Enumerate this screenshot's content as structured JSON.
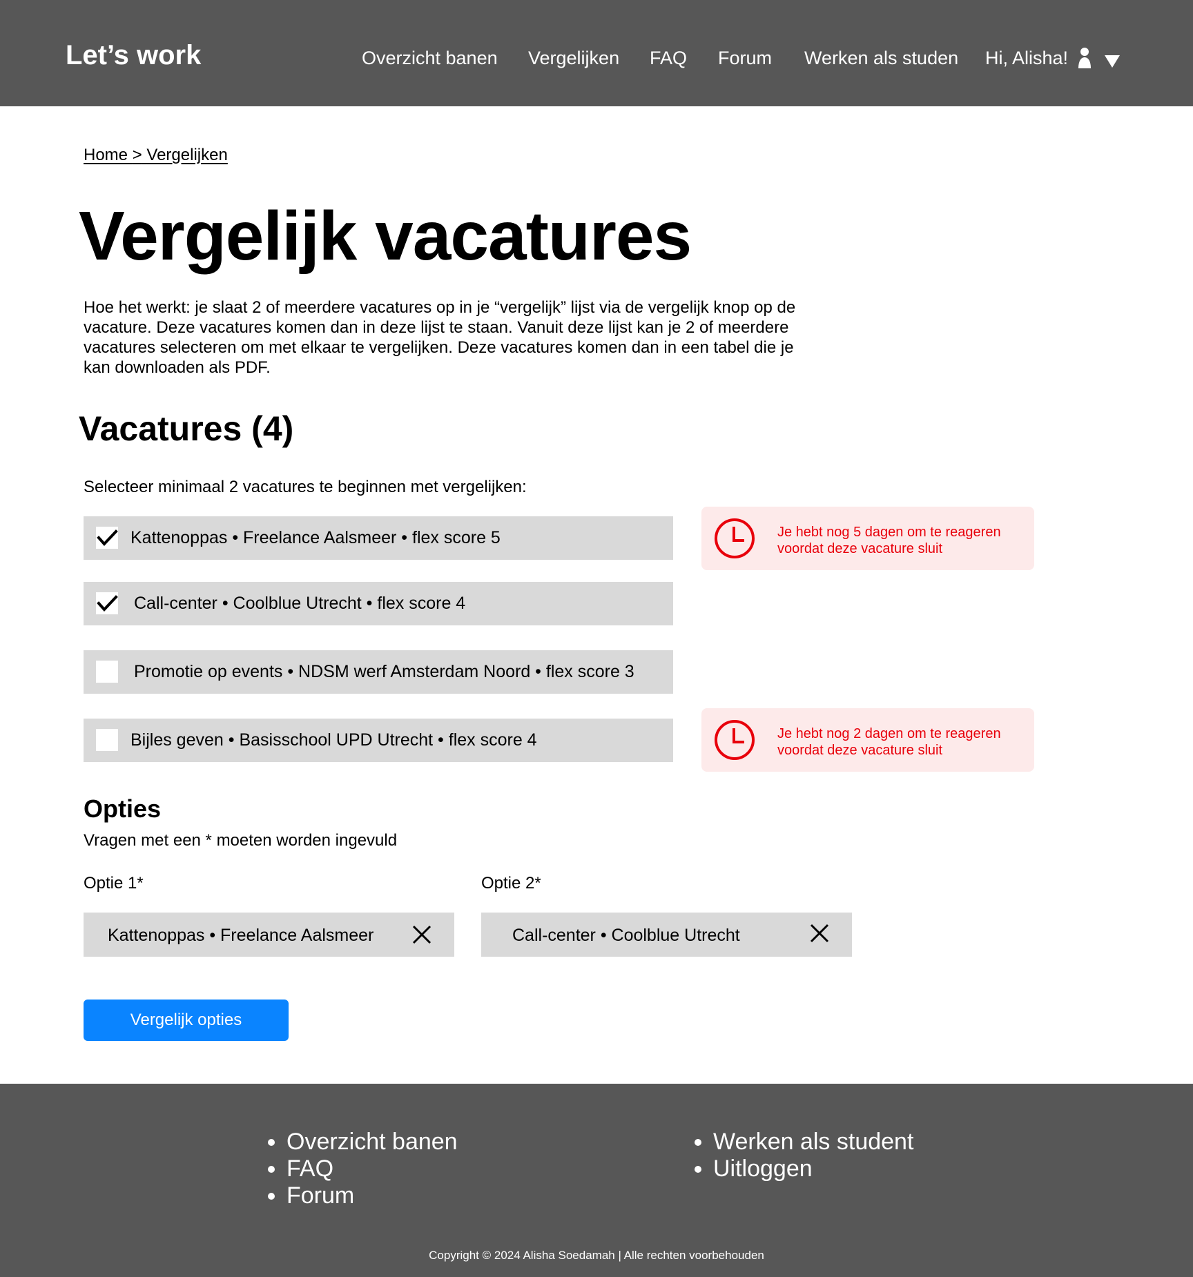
{
  "header": {
    "logo": "Let’s work",
    "nav": [
      "Overzicht banen",
      "Vergelijken",
      "FAQ",
      "Forum",
      "Werken als studen"
    ],
    "greeting": "Hi, Alisha!",
    "icons": [
      "user-icon",
      "dropdown-icon"
    ]
  },
  "breadcrumb": {
    "home": "Home",
    "separator": ">",
    "current": "Vergelijken"
  },
  "page_title": "Vergelijk vacatures",
  "intro": "Hoe het werkt: je slaat 2 of meerdere vacatures op in je “vergelijk” lijst via de vergelijk knop op de vacature. Deze vacatures komen dan in deze lijst te staan. Vanuit deze lijst kan je 2 of meerdere vacatures selecteren om met elkaar te vergelijken. Deze vacatures komen dan in een tabel die je kan downloaden als PDF.",
  "vacatures": {
    "title": "Vacatures (4)",
    "hint": "Selecteer minimaal 2 vacatures te beginnen met vergelijken:",
    "items": [
      {
        "label": "Kattenoppas • Freelance Aalsmeer • flex score 5",
        "checked": true,
        "alert": "Je hebt nog 5 dagen om te reageren voordat deze vacature sluit"
      },
      {
        "label": "Call-center • Coolblue Utrecht • flex score 4",
        "checked": true,
        "alert": null
      },
      {
        "label": "Promotie op events • NDSM werf Amsterdam Noord • flex score 3",
        "checked": false,
        "alert": null
      },
      {
        "label": "Bijles geven • Basisschool UPD Utrecht • flex score 4",
        "checked": false,
        "alert": "Je hebt nog 2 dagen om te reageren voordat deze vacature sluit"
      }
    ]
  },
  "opties": {
    "title": "Opties",
    "hint": "Vragen met een * moeten worden ingevuld",
    "fields": [
      {
        "label": "Optie 1*",
        "value": "Kattenoppas • Freelance Aalsmeer"
      },
      {
        "label": "Optie 2*",
        "value": "Call-center • Coolblue Utrecht"
      }
    ],
    "button": "Vergelijk opties"
  },
  "footer": {
    "links_left": [
      "Overzicht banen",
      "FAQ",
      "Forum"
    ],
    "links_right": [
      "Werken als student",
      "Uitloggen"
    ],
    "copyright": "Copyright © 2024 Alisha Soedamah | Alle rechten voorbehouden"
  },
  "colors": {
    "header_bg": "#575757",
    "row_bg": "#d9d9d9",
    "alert_bg": "#fdeaea",
    "alert_text": "#e8000b",
    "button_bg": "#0a84ff"
  }
}
